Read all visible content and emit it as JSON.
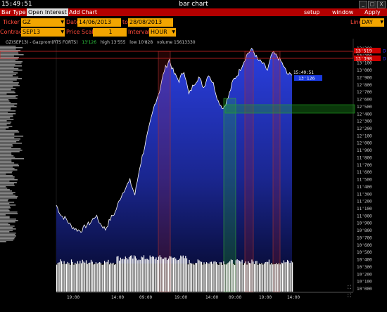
{
  "window": {
    "clock": "15:49:51",
    "title": "bar chart",
    "controls": [
      "_",
      "□",
      "X"
    ]
  },
  "menu": {
    "bar_type": "Bar Type",
    "open_interest": "Open Interest",
    "add_chart": "Add Chart",
    "setup": "setup",
    "window": "window",
    "apply": "Apply"
  },
  "params": {
    "ticker_label": "Ticker",
    "ticker": "GZ",
    "date_label": "Date",
    "date_from": "14/06/2013",
    "to_label": "to",
    "date_to": "28/08/2013",
    "line_label": "Line",
    "line": "DAY",
    "contract_label": "Contract",
    "contract": "SEP13",
    "price_scale_label": "Price Scale",
    "price_scale": "1",
    "interval_label": "Interval",
    "interval": "HOUR"
  },
  "chart": {
    "title": "GZ(SEP13) - Gazprom(RTS FORTS)",
    "last": "13'126",
    "high": "high 13'555",
    "low": "low 10'828",
    "volume": "volume 15613330",
    "marker_top": "13'519",
    "marker_mid": "13'398",
    "marker_cur": "13'126",
    "marker_time": "15:49:51",
    "marker_flags": [
      "D",
      "D"
    ],
    "y_labels": [
      "13'300",
      "13'200",
      "13'100",
      "13'000",
      "12'900",
      "12'800",
      "12'700",
      "12'600",
      "12'500",
      "12'400",
      "12'300",
      "12'200",
      "12'100",
      "12'000",
      "11'900",
      "11'800",
      "11'700",
      "11'600",
      "11'500",
      "11'400",
      "11'300",
      "11'200",
      "11'100",
      "11'000",
      "10'900",
      "10'800",
      "10'700",
      "10'600",
      "10'500",
      "10'400",
      "10'300",
      "10'200",
      "10'100",
      "10'000"
    ],
    "x_labels": [
      "19:00",
      "14:00",
      "09:00",
      "19:00",
      "14:00",
      "09:00",
      "19:00",
      "14:00"
    ],
    "colors": {
      "area": "#2233cc",
      "price": "#ffffff",
      "volume": "#ffffff",
      "bg": "#000000"
    }
  },
  "chart_data": {
    "type": "area",
    "x_categories": [
      "19:00",
      "14:00",
      "09:00",
      "19:00",
      "14:00",
      "09:00",
      "19:00",
      "14:00"
    ],
    "ylim": [
      10000,
      13555
    ],
    "series": [
      {
        "values": [
          11250,
          11100,
          11050,
          10950,
          10900,
          10880,
          10950,
          11000,
          11100,
          10980,
          10900,
          11050,
          11150,
          11350,
          11500,
          11600,
          11400,
          11800,
          12100,
          12400,
          12700,
          12900,
          13200,
          13350,
          13150,
          13050,
          13200,
          12850,
          13000,
          13100,
          12950,
          13150,
          13000,
          12750,
          12650,
          12800,
          13050,
          13150,
          13300,
          13450,
          13500,
          13350,
          13300,
          13200,
          13450,
          13400,
          13300,
          13150,
          13126
        ]
      }
    ]
  }
}
